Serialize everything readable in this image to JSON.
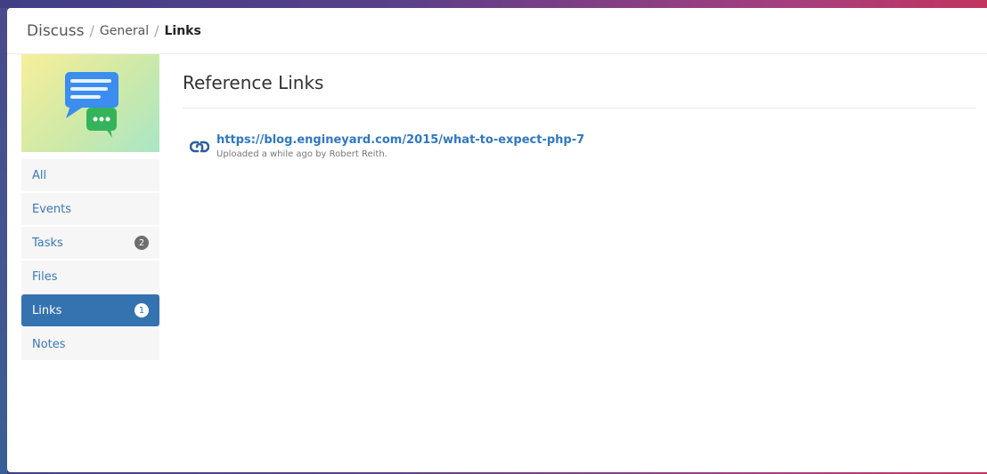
{
  "breadcrumb": {
    "root": "Discuss",
    "separator": "/",
    "section": "General",
    "current": "Links"
  },
  "sidebar": {
    "hero_icon": "chat-bubbles-icon",
    "items": [
      {
        "label": "All",
        "badge": null,
        "active": false
      },
      {
        "label": "Events",
        "badge": null,
        "active": false
      },
      {
        "label": "Tasks",
        "badge": "2",
        "active": false
      },
      {
        "label": "Files",
        "badge": null,
        "active": false
      },
      {
        "label": "Links",
        "badge": "1",
        "active": true
      },
      {
        "label": "Notes",
        "badge": null,
        "active": false
      }
    ]
  },
  "main": {
    "title": "Reference Links",
    "links": [
      {
        "icon": "link-icon",
        "url": "https://blog.engineyard.com/2015/what-to-expect-php-7",
        "meta": "Uploaded a while ago by Robert Reith."
      }
    ]
  },
  "colors": {
    "accent": "#3572b0",
    "link": "#2f78c4"
  }
}
